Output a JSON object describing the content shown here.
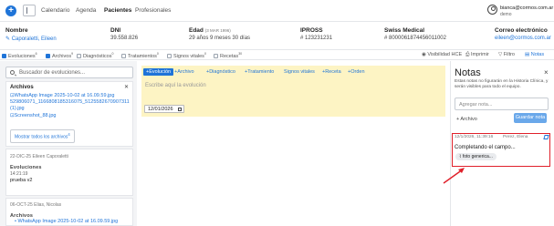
{
  "app": {
    "nav": [
      "Calendario",
      "Agenda",
      "Pacientes",
      "Profesionales"
    ],
    "active_nav": "Pacientes",
    "user_email": "bianca@cormos.com.ar",
    "user_org": "demo"
  },
  "patient": {
    "nombre_label": "Nombre",
    "nombre": "Caporaletti, Eileen",
    "dni_label": "DNI",
    "dni": "39.558.826",
    "edad_label": "Edad",
    "edad_dob": "(3 MAR 1996)",
    "edad": "29 años 9 meses 30 días",
    "ipross_label": "IPROSS",
    "ipross": "# 123231231",
    "swiss_label": "Swiss Medical",
    "swiss": "# 8000061874456011002",
    "email_label": "Correo electrónico",
    "email": "eileen@cormos.com.ar"
  },
  "filters": {
    "items": [
      {
        "label": "Evoluciones",
        "count": "6",
        "checked": true
      },
      {
        "label": "Archivos",
        "count": "9",
        "checked": true
      },
      {
        "label": "Diagnósticos",
        "count": "0",
        "checked": false
      },
      {
        "label": "Tratamientos",
        "count": "0",
        "checked": false
      },
      {
        "label": "Signos vitales",
        "count": "0",
        "checked": false
      },
      {
        "label": "Recetas",
        "count": "30",
        "checked": false
      }
    ],
    "tools": [
      "Visibilidad HCE",
      "Imprimir",
      "Filtro",
      "Notas"
    ]
  },
  "left": {
    "search_placeholder": "Buscador de evoluciones...",
    "archivos_title": "Archivos",
    "files": [
      "WhatsApp Image 2025-10-02 at 16.09.59.jpg",
      "529806071_1166808185316075_5125582670907311",
      "(1).jpg",
      "Screenshot_88.jpg"
    ],
    "show_all": "Mostrar todos los archivos",
    "show_all_count": "4",
    "entry1": {
      "head": "22-DIC-25   Eileen Caporaletti",
      "type": "Evoluciones",
      "time": "14:21:19",
      "text": "prueba v2"
    },
    "entry2": {
      "head": "06-OCT-25   Elias, Nicolas",
      "type": "Archivos",
      "text": "WhatsApp Image 2025-10-02 at 16.09.59.jpg"
    }
  },
  "editor": {
    "tabs": [
      "+Evolución",
      "+Archivo",
      "+Diagnóstico",
      "+Tratamiento",
      "Signos vitales",
      "+Receta",
      "+Orden"
    ],
    "placeholder": "Escribe aquí la evolución",
    "date": "12/01/2026"
  },
  "notes": {
    "title": "Notas",
    "close": "×",
    "description": "Estas notas no figurarán en la Historia Clínica, y serán visibles para todo el equipo.",
    "input_placeholder": "Agregar nota...",
    "add_file": "+ Archivo",
    "save": "Guardar nota",
    "note": {
      "date": "12/1/2026, 11:39:16",
      "author": "Perez, Elena",
      "text": "Completando el campo...",
      "attachment": "foto generica..."
    }
  },
  "colors": {
    "accent": "#1f74d8",
    "editor_bg": "#fdf4c4",
    "highlight": "#e0202a"
  }
}
